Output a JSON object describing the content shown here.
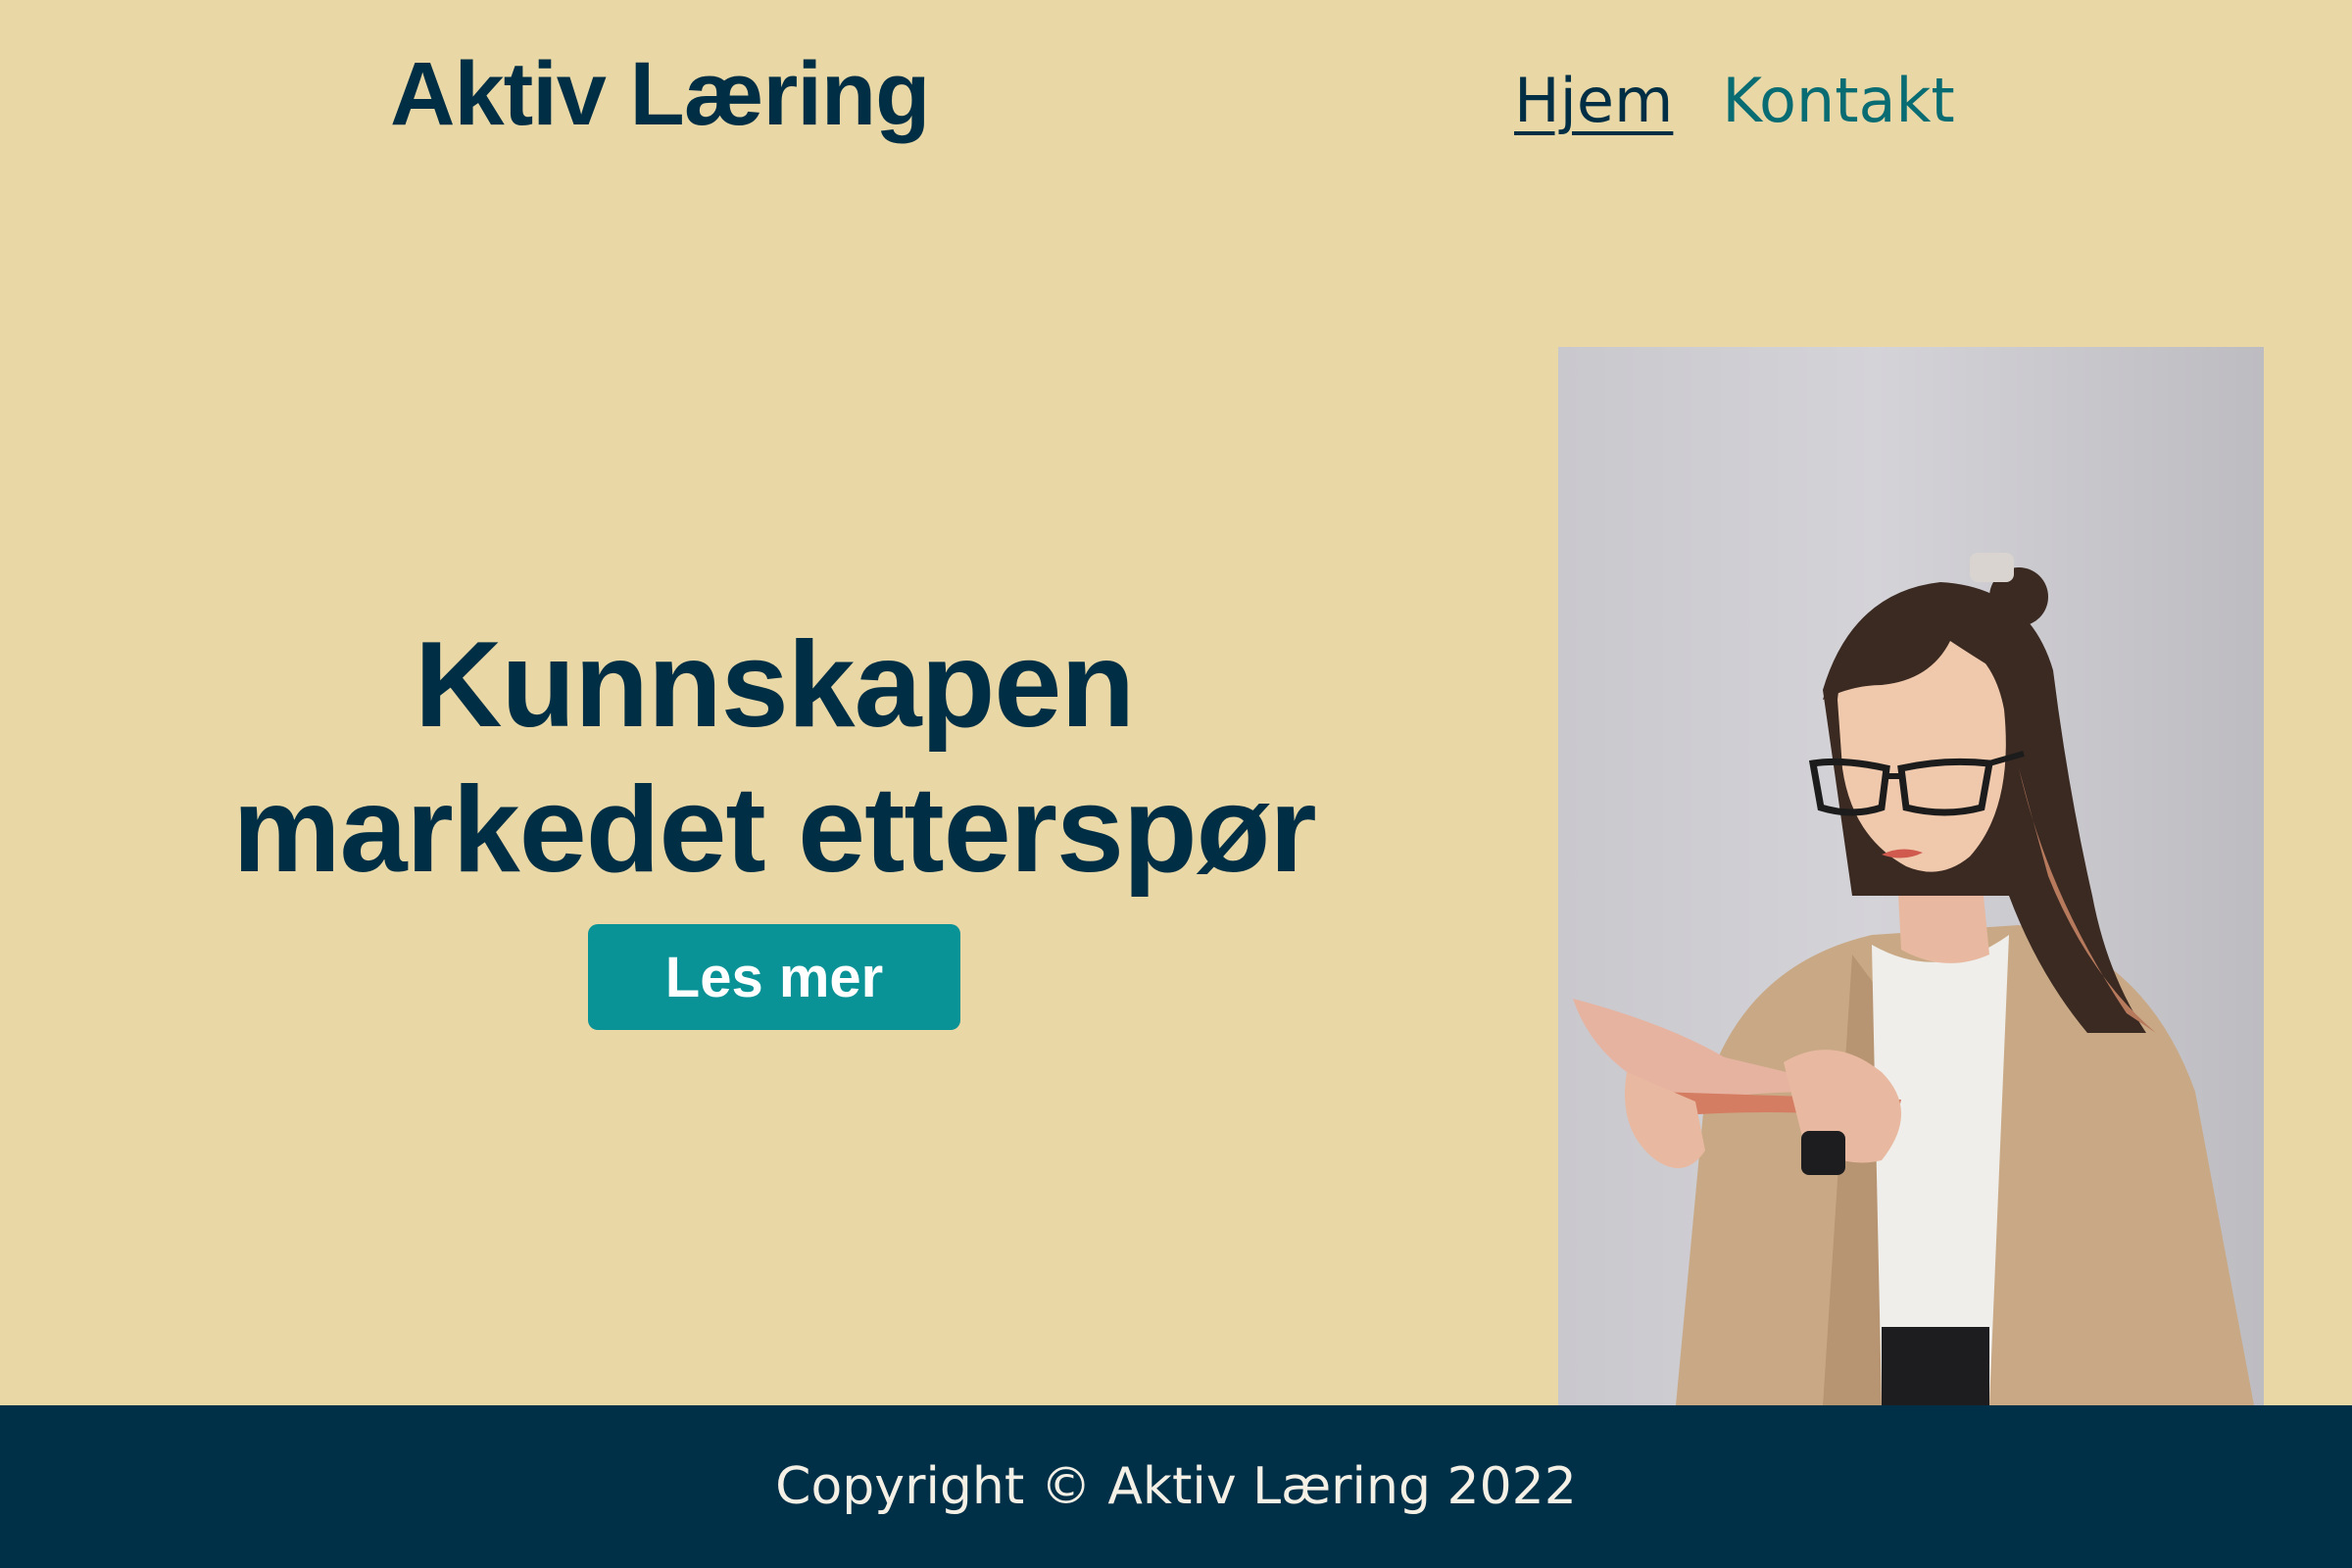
{
  "header": {
    "brand": "Aktiv Læring",
    "nav": [
      {
        "label": "Hjem"
      },
      {
        "label": "Kontakt"
      }
    ]
  },
  "hero": {
    "title_line1": "Kunnskapen",
    "title_line2": "markedet etterspør",
    "cta_label": "Les mer",
    "image_alt": "Kvinne med briller som leser en bok"
  },
  "footer": {
    "copyright": "Copyright © Aktiv Læring 2022"
  },
  "colors": {
    "background": "#e9d8a6",
    "primary_text": "#002f45",
    "nav_link": "#0a6c73",
    "cta_background": "#0a9396",
    "footer_background": "#003048",
    "footer_text": "#f5f0e6"
  }
}
